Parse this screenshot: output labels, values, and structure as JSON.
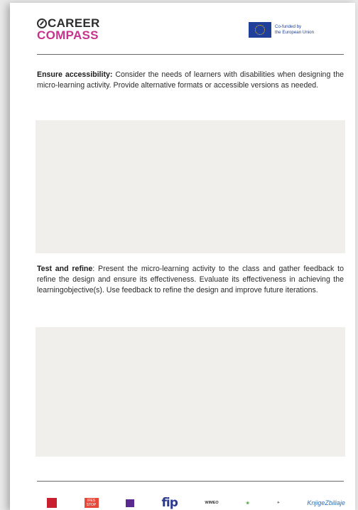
{
  "header": {
    "logo_line1": "CAREER",
    "logo_line2": "COMPASS",
    "eu_line1": "Co-funded by",
    "eu_line2": "the European Union"
  },
  "sections": [
    {
      "heading": "Ensure accessibility:",
      "body": " Consider the needs of learners with disabilities when designing the micro-learning activity. Provide alternative formats or accessible versions as needed."
    },
    {
      "heading": "Test and refine",
      "body": ": Present the micro-learning activity to the class and gather feedback to refine the design and ensure its effectiveness. Evaluate its effectiveness in achieving the learningobjective(s). Use feedback to refine the design and improve future iterations."
    }
  ],
  "footer": {
    "partners": {
      "p2": "IFES STOP",
      "p4": "fip",
      "p5": "WIMEO",
      "p8": "KnjigeZbiliaje"
    }
  },
  "colors": {
    "brand_pink": "#c7338c",
    "eu_blue": "#1f3f9a",
    "box_fill": "#f0efeb"
  }
}
